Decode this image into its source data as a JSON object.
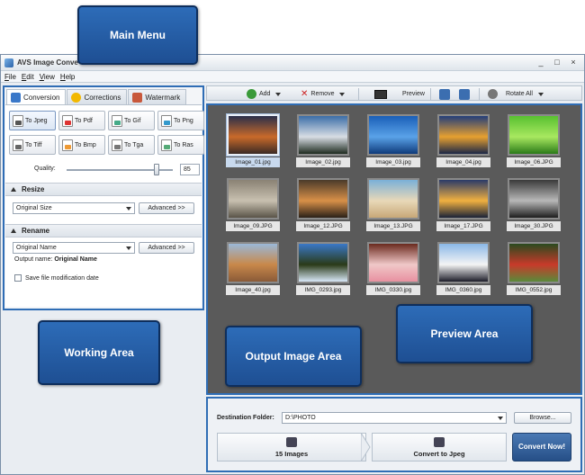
{
  "window": {
    "title": "AVS Image Conve",
    "controls": [
      "_",
      "□",
      "×"
    ]
  },
  "menu": [
    "File",
    "Edit",
    "View",
    "Help"
  ],
  "tabs": [
    {
      "label": "Conversion",
      "color": "#3a78c9"
    },
    {
      "label": "Corrections",
      "color": "#f2b800"
    },
    {
      "label": "Watermark",
      "color": "#c8583b"
    }
  ],
  "formats": [
    {
      "label": "To Jpeg",
      "icon": "jpeg-icon",
      "cls": "ico-jpeg"
    },
    {
      "label": "To Pdf",
      "icon": "pdf-icon",
      "cls": "ico-pdf"
    },
    {
      "label": "To Gif",
      "icon": "gif-icon",
      "cls": "ico-gif"
    },
    {
      "label": "To Png",
      "icon": "png-icon",
      "cls": "ico-png"
    },
    {
      "label": "To Tiff",
      "icon": "tiff-icon",
      "cls": "ico-tiff"
    },
    {
      "label": "To Bmp",
      "icon": "bmp-icon",
      "cls": "ico-bmp"
    },
    {
      "label": "To Tga",
      "icon": "tga-icon",
      "cls": "ico-tga"
    },
    {
      "label": "To Ras",
      "icon": "ras-icon",
      "cls": "ico-ras"
    }
  ],
  "quality": {
    "label": "Quality:",
    "value": "85",
    "level_fraction": 0.85
  },
  "resize": {
    "header": "Resize",
    "selected": "Original Size",
    "advanced": "Advanced >>"
  },
  "rename": {
    "header": "Rename",
    "selected": "Original Name",
    "advanced": "Advanced >>",
    "output_label": "Output name:",
    "output_value": "Original Name"
  },
  "save_date": {
    "label": "Save file modification date",
    "checked": false
  },
  "toolbar": {
    "add": "Add",
    "remove": "Remove",
    "preview": "Preview",
    "rotate_all": "Rotate All"
  },
  "images": [
    {
      "name": "Image_01.jpg",
      "colors": [
        "#2a2f4a",
        "#c96a2a",
        "#3a2a25"
      ],
      "selected": true
    },
    {
      "name": "Image_02.jpg",
      "colors": [
        "#3c6ea8",
        "#d8dde4",
        "#1d2a1e"
      ],
      "selected": false
    },
    {
      "name": "Image_03.jpg",
      "colors": [
        "#1a5fb8",
        "#5aa2e8",
        "#0e3a7a"
      ],
      "selected": false
    },
    {
      "name": "Image_04.jpg",
      "colors": [
        "#233e7a",
        "#e6a030",
        "#1a2646"
      ],
      "selected": false
    },
    {
      "name": "Image_06.JPG",
      "colors": [
        "#58c030",
        "#a8e860",
        "#2a7a18"
      ],
      "selected": false
    },
    {
      "name": "Image_09.JPG",
      "colors": [
        "#8a8274",
        "#c8c0b0",
        "#5a5448"
      ],
      "selected": false
    },
    {
      "name": "Image_12.JPG",
      "colors": [
        "#4a3a2a",
        "#d89048",
        "#2a2018"
      ],
      "selected": false
    },
    {
      "name": "Image_13.JPG",
      "colors": [
        "#7ab0d8",
        "#e8d8b8",
        "#c8a878"
      ],
      "selected": false
    },
    {
      "name": "Image_17.JPG",
      "colors": [
        "#2a3a68",
        "#f0b040",
        "#1a2238"
      ],
      "selected": false
    },
    {
      "name": "Image_30.JPG",
      "colors": [
        "#3a3a3a",
        "#b8b8b8",
        "#1e1e1e"
      ],
      "selected": false
    },
    {
      "name": "Image_40.jpg",
      "colors": [
        "#9ab8d8",
        "#c8884a",
        "#8a5a38"
      ],
      "selected": false
    },
    {
      "name": "IMG_0293.jpg",
      "colors": [
        "#3a78c8",
        "#2a3a18",
        "#d8e8f8"
      ],
      "selected": false
    },
    {
      "name": "IMG_0330.jpg",
      "colors": [
        "#6a2a1e",
        "#f0c8c8",
        "#e890a0"
      ],
      "selected": false
    },
    {
      "name": "IMG_0360.jpg",
      "colors": [
        "#8ab8e8",
        "#f4f4f4",
        "#1e1e2a"
      ],
      "selected": false
    },
    {
      "name": "IMG_0552.jpg",
      "colors": [
        "#2a4a1e",
        "#c83a2a",
        "#5a8a3a"
      ],
      "selected": false
    }
  ],
  "output": {
    "dest_label": "Destination Folder:",
    "dest_value": "D:\\PHOTO",
    "browse": "Browse...",
    "count": "15 Images",
    "target": "Convert to Jpeg",
    "convert": "Convert Now!"
  },
  "callouts": {
    "main_menu": "Main Menu",
    "working_area": "Working Area",
    "preview_area": "Preview Area",
    "output_area": "Output Image Area"
  },
  "colors": {
    "accent": "#2f6db5",
    "callout": "#1e4f93",
    "preview_bg": "#5a5a5a"
  }
}
